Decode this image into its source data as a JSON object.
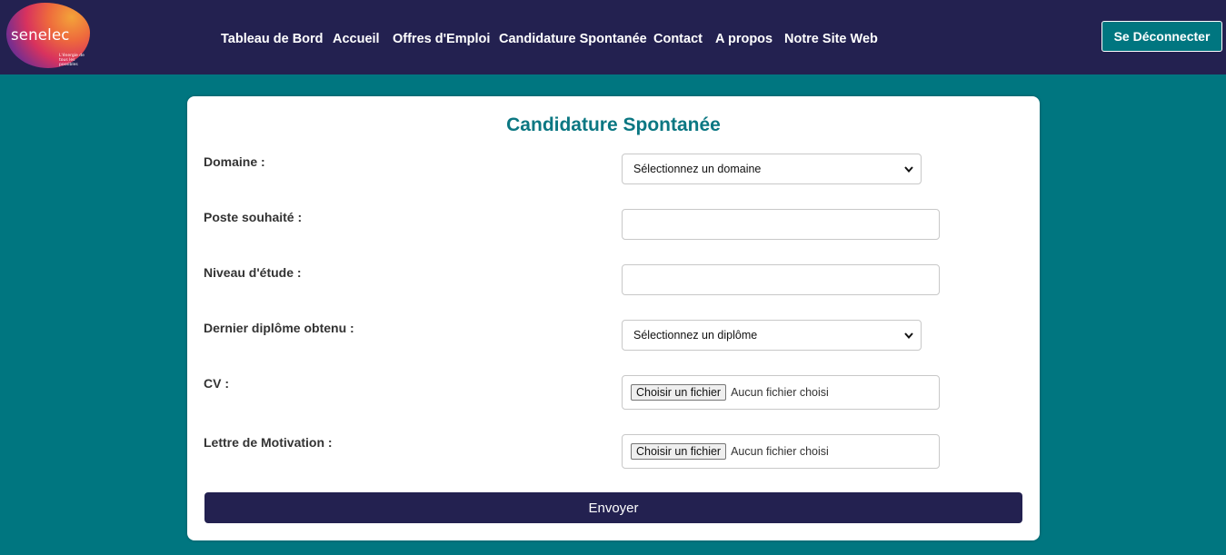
{
  "brand": {
    "name": "senelec",
    "tagline": "L'énergie de tous les possibles",
    "colors": {
      "navbar": "#232150",
      "accent": "#007680",
      "title": "#0b7782"
    }
  },
  "nav": {
    "links": [
      "Tableau de Bord",
      "Accueil",
      "Offres d'Emploi",
      "Candidature Spontanée",
      "Contact",
      "A propos",
      "Notre Site Web"
    ],
    "logout_label": "Se Déconnecter"
  },
  "form": {
    "title": "Candidature Spontanée",
    "domaine": {
      "label": "Domaine :",
      "selected": "Sélectionnez un domaine"
    },
    "poste": {
      "label": "Poste souhaité :",
      "value": ""
    },
    "niveau": {
      "label": "Niveau d'étude :",
      "value": ""
    },
    "diplome": {
      "label": "Dernier diplôme obtenu :",
      "selected": "Sélectionnez un diplôme"
    },
    "cv": {
      "label": "CV :",
      "button": "Choisir un fichier",
      "status": "Aucun fichier choisi"
    },
    "lettre": {
      "label": "Lettre de Motivation :",
      "button": "Choisir un fichier",
      "status": "Aucun fichier choisi"
    },
    "submit_label": "Envoyer"
  },
  "icons": {
    "logo": "senelec-logo",
    "select_arrow": "chevron-down-icon"
  }
}
